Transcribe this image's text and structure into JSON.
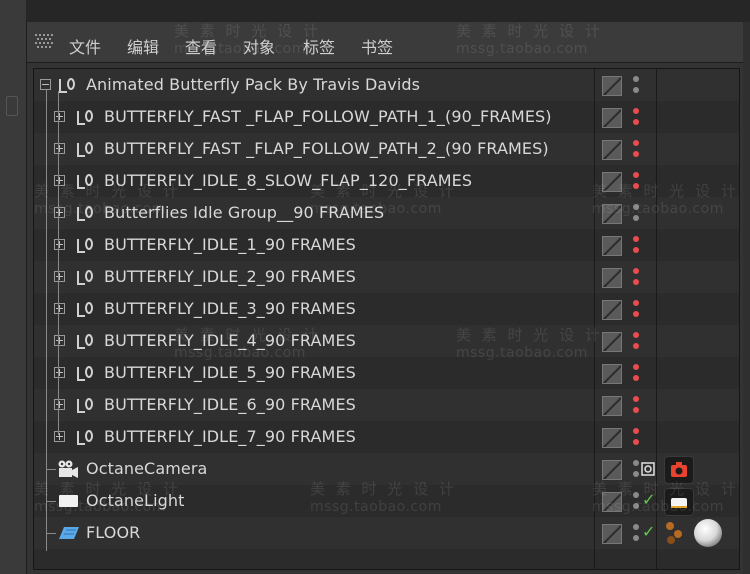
{
  "menu": {
    "items": [
      {
        "label": "文件"
      },
      {
        "label": "编辑"
      },
      {
        "label": "查看"
      },
      {
        "label": "对象"
      },
      {
        "label": "标签"
      },
      {
        "label": "书签"
      }
    ]
  },
  "objects": [
    {
      "label": "Animated Butterfly Pack By Travis Davids",
      "level": 0,
      "icon": "null-icon"
    },
    {
      "label": "BUTTERFLY_FAST _FLAP_FOLLOW_PATH_1_(90_FRAMES)",
      "level": 1,
      "icon": "null-icon"
    },
    {
      "label": "BUTTERFLY_FAST _FLAP_FOLLOW_PATH_2_(90 FRAMES)",
      "level": 1,
      "icon": "null-icon"
    },
    {
      "label": "BUTTERFLY_IDLE_8_SLOW_FLAP_120_FRAMES",
      "level": 1,
      "icon": "null-icon"
    },
    {
      "label": "Butterflies Idle Group__90 FRAMES",
      "level": 1,
      "icon": "null-icon"
    },
    {
      "label": "BUTTERFLY_IDLE_1_90 FRAMES",
      "level": 1,
      "icon": "null-icon"
    },
    {
      "label": "BUTTERFLY_IDLE_2_90 FRAMES",
      "level": 1,
      "icon": "null-icon"
    },
    {
      "label": "BUTTERFLY_IDLE_3_90 FRAMES",
      "level": 1,
      "icon": "null-icon"
    },
    {
      "label": "BUTTERFLY_IDLE_4_90 FRAMES",
      "level": 1,
      "icon": "null-icon"
    },
    {
      "label": "BUTTERFLY_IDLE_5_90 FRAMES",
      "level": 1,
      "icon": "null-icon"
    },
    {
      "label": "BUTTERFLY_IDLE_6_90 FRAMES",
      "level": 1,
      "icon": "null-icon"
    },
    {
      "label": "BUTTERFLY_IDLE_7_90 FRAMES",
      "level": 1,
      "icon": "null-icon"
    },
    {
      "label": "OctaneCamera",
      "level": 0,
      "icon": "camera-icon"
    },
    {
      "label": "OctaneLight",
      "level": 0,
      "icon": "light-icon"
    },
    {
      "label": "FLOOR",
      "level": 0,
      "icon": "floor-icon"
    }
  ],
  "watermark": {
    "text": "美 素 时 光 设 计",
    "url": "mssg.taobao.com"
  },
  "colors": {
    "dot_on": "#e84c4c",
    "dot_off": "#8a8a8a",
    "check": "#62c84d",
    "camera_tag": "#e8432f"
  }
}
